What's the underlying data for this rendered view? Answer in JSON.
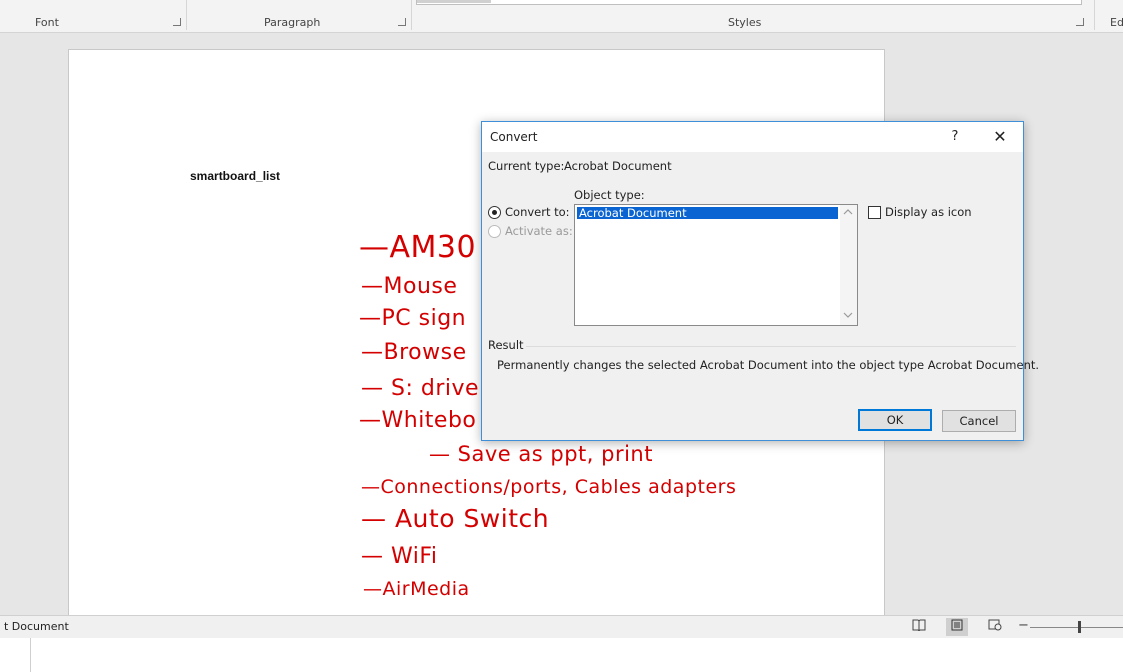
{
  "ribbon": {
    "groups": [
      "Font",
      "Paragraph",
      "Styles"
    ],
    "editing_partial": "Ed"
  },
  "document": {
    "title": "smartboard_list",
    "handwritten_lines": [
      "—AM30",
      "—Mouse",
      "—PC sign",
      "—Browse",
      "— S: drive",
      "—Whitebo",
      "— Save as ppt, print",
      "—Connections/ports, Cables adapters",
      "— Auto Switch",
      "— WiFi",
      "—AirMedia"
    ],
    "ink_color": "#d40000"
  },
  "status_bar": {
    "text": "t Document",
    "view_icons": [
      "read-mode-icon",
      "print-layout-icon",
      "web-layout-icon"
    ],
    "zoom_minus": "−"
  },
  "dialog": {
    "title": "Convert",
    "help": "?",
    "close": "✕",
    "current_type_label": "Current type:",
    "current_type_value": "Acrobat Document",
    "object_type_label": "Object type:",
    "convert_to_label": "Convert to:",
    "activate_as_label": "Activate as:",
    "list_items": [
      "Acrobat Document"
    ],
    "display_as_icon_label": "Display as icon",
    "result_label": "Result",
    "result_text": "Permanently changes the selected Acrobat Document into the object type Acrobat Document.",
    "ok_label": "OK",
    "cancel_label": "Cancel",
    "accent_color": "#0078d7"
  }
}
